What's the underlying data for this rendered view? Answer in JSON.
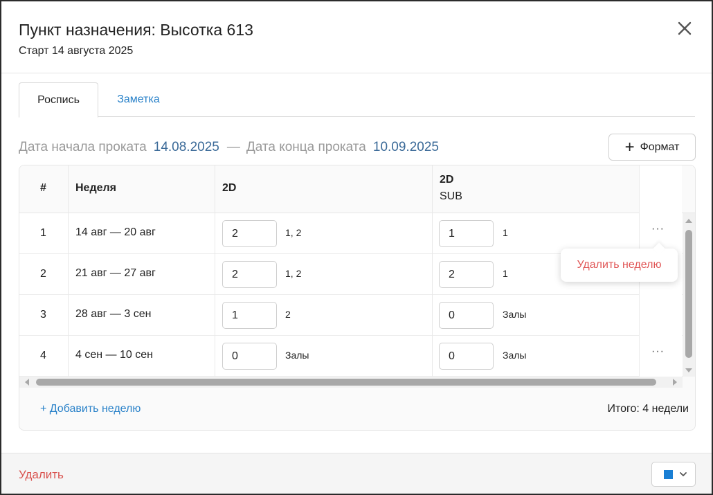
{
  "header": {
    "title": "Пункт назначения: Высотка 613",
    "subtitle": "Старт 14 августа 2025"
  },
  "tabs": [
    {
      "label": "Роспись",
      "active": true
    },
    {
      "label": "Заметка",
      "active": false
    }
  ],
  "dates": {
    "start_label": "Дата начала проката",
    "start_value": "14.08.2025",
    "separator": "—",
    "end_label": "Дата конца проката",
    "end_value": "10.09.2025"
  },
  "format_button": {
    "label": "Формат",
    "icon": "plus-icon"
  },
  "table": {
    "columns": {
      "num": "#",
      "week": "Неделя",
      "col1": {
        "title": "2D"
      },
      "col2": {
        "title": "2D",
        "sub": "SUB"
      }
    },
    "rows": [
      {
        "num": "1",
        "week": "14 авг — 20 авг",
        "c1": {
          "value": "2",
          "halls": "1, 2"
        },
        "c2": {
          "value": "1",
          "halls": "1"
        },
        "more": "···"
      },
      {
        "num": "2",
        "week": "21 авг — 27 авг",
        "c1": {
          "value": "2",
          "halls": "1, 2"
        },
        "c2": {
          "value": "2",
          "halls": "1"
        },
        "more": ""
      },
      {
        "num": "3",
        "week": "28 авг — 3 сен",
        "c1": {
          "value": "1",
          "halls": "2"
        },
        "c2": {
          "value": "0",
          "halls": "Залы"
        },
        "more": ""
      },
      {
        "num": "4",
        "week": "4 сен — 10 сен",
        "c1": {
          "value": "0",
          "halls": "Залы"
        },
        "c2": {
          "value": "0",
          "halls": "Залы"
        },
        "more": "···"
      }
    ],
    "add_week": "+ Добавить неделю",
    "total": "Итого: 4 недели"
  },
  "popover": {
    "label": "Удалить неделю"
  },
  "footer": {
    "delete_label": "Удалить",
    "color_value": "#1a7fd4"
  }
}
